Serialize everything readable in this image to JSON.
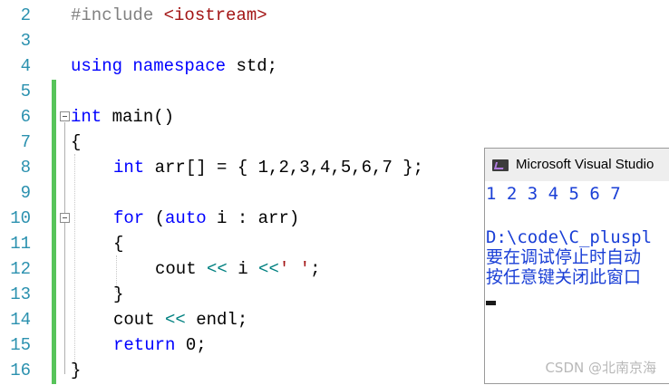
{
  "editor": {
    "line_numbers": [
      "2",
      "3",
      "4",
      "5",
      "6",
      "7",
      "8",
      "9",
      "10",
      "11",
      "12",
      "13",
      "14",
      "15",
      "16"
    ],
    "lines": {
      "l2": {
        "pp": "#include ",
        "hdr": "<iostream>"
      },
      "l4": {
        "kw1": "using",
        "kw2": "namespace",
        "rest": " std;"
      },
      "l6": {
        "kw": "int",
        "rest": " main()"
      },
      "l7": {
        "text": "{"
      },
      "l8": {
        "kw": "int",
        "rest": " arr[] = { 1,2,3,4,5,6,7 };"
      },
      "l10": {
        "kw1": "for",
        "p1": " (",
        "kw2": "auto",
        "rest": " i : arr)"
      },
      "l11": {
        "text": "{"
      },
      "l12": {
        "a": "cout ",
        "op1": "<<",
        "b": " i ",
        "op2": "<<",
        "str": "' '",
        "c": ";"
      },
      "l13": {
        "text": "}"
      },
      "l14": {
        "a": "cout ",
        "op": "<<",
        "b": " endl;"
      },
      "l15": {
        "kw": "return",
        "rest": " 0;"
      },
      "l16": {
        "text": "}"
      }
    }
  },
  "console": {
    "title": "Microsoft Visual Studio",
    "output_lines": [
      "1 2 3 4 5 6 7",
      "",
      "D:\\code\\C_pluspl",
      "要在调试停止时自动",
      "按任意键关闭此窗口"
    ]
  },
  "watermark": "CSDN @北南京海",
  "colors": {
    "keyword": "#0000ff",
    "string": "#a31515",
    "preprocessor": "#808080",
    "line_number": "#2b91af",
    "change_bar": "#57c45a",
    "console_text": "#1a3fd6"
  }
}
